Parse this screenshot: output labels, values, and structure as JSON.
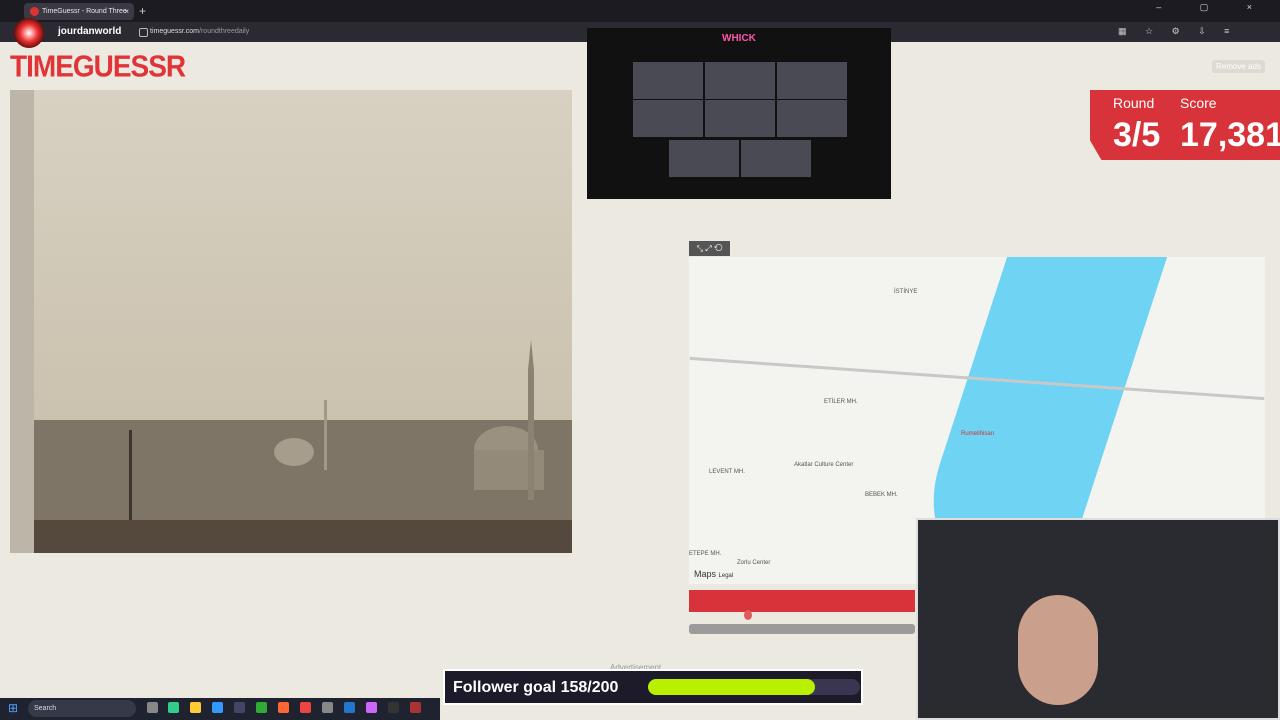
{
  "browser": {
    "tab_title": "TimeGuessr - Round Three",
    "tab_close": "×",
    "new_tab": "+",
    "url_host": "timeguessr.com",
    "url_path": "/roundthreedaily",
    "window_controls": "– ▢ ×",
    "toolbar_icons": "▦ ☆ ⚙ ⇩ ≡"
  },
  "stream": {
    "channel_name": "jourdanworld",
    "webcam_brand": "WHICK",
    "follower_goal_text": "Follower goal 158/200",
    "follower_goal_progress": 0.79
  },
  "page": {
    "logo": "TIMEGUESSR",
    "remove_ads": "Remove ads",
    "round_label": "Round",
    "round_value": "3/5",
    "score_label": "Score",
    "score_value": "17,381",
    "advertisement": "Advertisement"
  },
  "map": {
    "tools": "⤡ ⤢ ⟲",
    "brand": "Maps",
    "legal": "Legal",
    "labels": {
      "etiler": "ETİLER MH.",
      "levent": "LEVENT MH.",
      "bebek": "BEBEK MH.",
      "akatlar": "Akatlar Culture Center",
      "rumeli": "Rumelihisarı",
      "zorlu": "Zorlu Center",
      "istinye": "İSTİNYE",
      "tepe": "ETEPE MH."
    }
  },
  "taskbar": {
    "search_placeholder": "Search"
  },
  "colors": {
    "accent_red": "#d8333a",
    "page_bg": "#ece9e0",
    "bosphorus": "#6fd3f4",
    "goal_fill": "#b8f000"
  }
}
